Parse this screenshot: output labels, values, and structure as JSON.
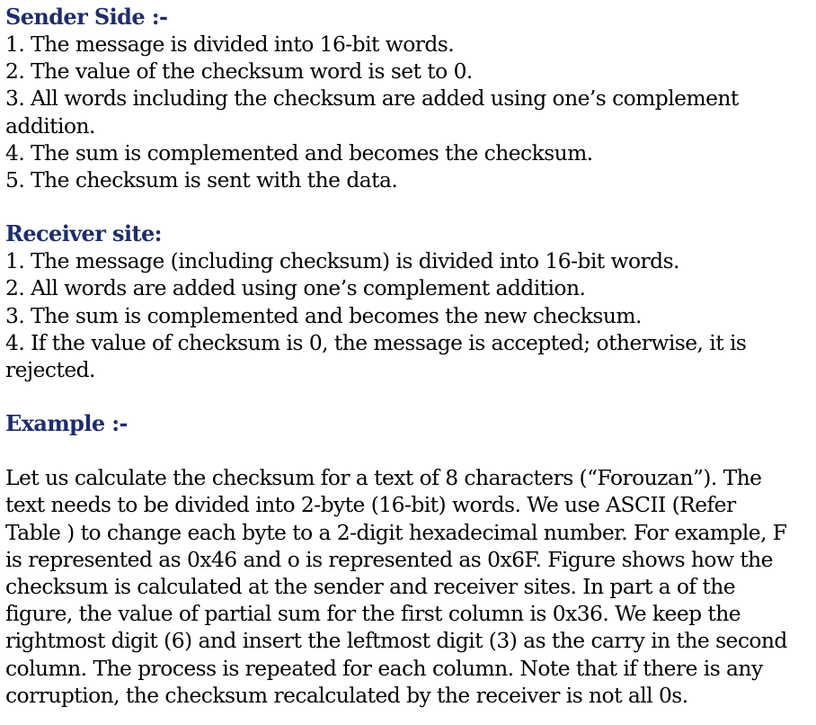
{
  "sender": {
    "heading": "Sender Side :-",
    "lines": [
      "1. The message is divided into 16-bit words.",
      "2. The value of the checksum word is set to 0.",
      "3. All words including the checksum are added using one’s complement",
      "addition.",
      "4. The sum is complemented and becomes the checksum.",
      "5. The checksum is sent with the data."
    ]
  },
  "receiver": {
    "heading": "Receiver site:",
    "lines": [
      "1. The message (including checksum) is divided into 16-bit words.",
      "2. All words are added using one’s complement addition.",
      "3. The sum is complemented and becomes the new checksum.",
      "4. If the value of checksum is 0, the message is accepted; otherwise, it is",
      "rejected."
    ]
  },
  "example": {
    "heading": "Example :-",
    "lines": [
      "Let us calculate the checksum for a text of 8 characters (“Forouzan”). The",
      "text needs to be divided into 2-byte (16-bit) words. We use ASCII (Refer",
      "Table ) to change each byte to a 2-digit hexadecimal number. For example, F",
      "is represented as 0x46 and o is represented as 0x6F. Figure shows how the",
      "checksum is calculated at the sender and receiver sites. In part a of the",
      "figure, the value of partial sum for the first column is 0x36. We keep the",
      "rightmost digit (6) and insert the leftmost digit (3) as the carry in the second",
      "column. The process is repeated for each column. Note that if there is any",
      "corruption, the checksum recalculated by the receiver is not all 0s."
    ]
  }
}
